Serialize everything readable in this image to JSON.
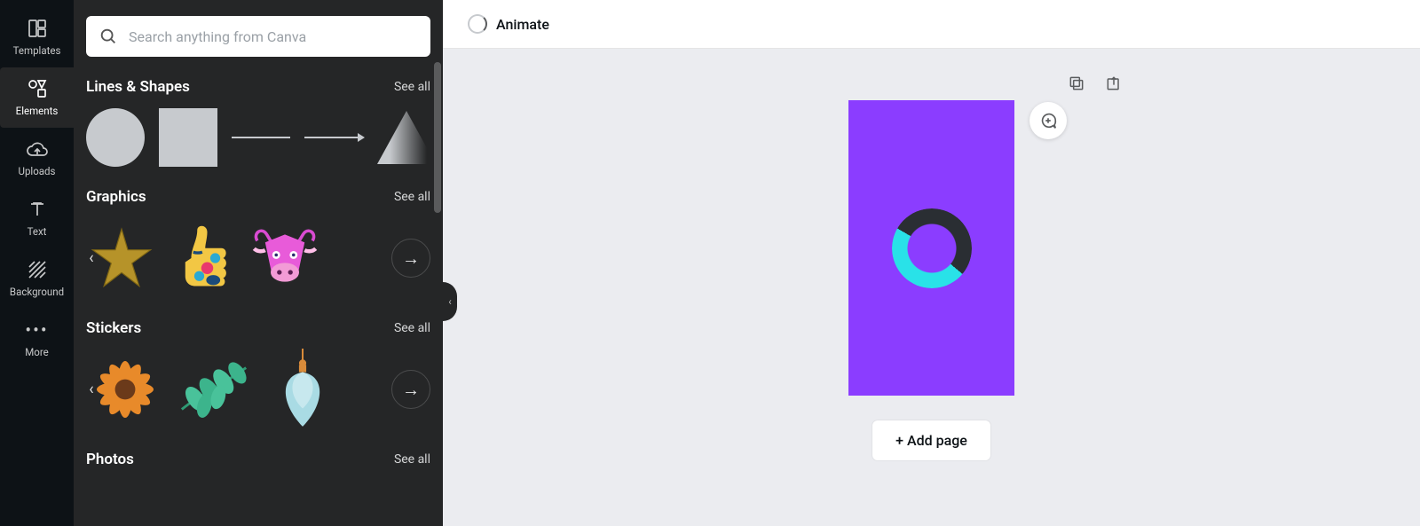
{
  "rail": {
    "items": [
      {
        "label": "Templates",
        "icon": "templates"
      },
      {
        "label": "Elements",
        "icon": "elements"
      },
      {
        "label": "Uploads",
        "icon": "uploads"
      },
      {
        "label": "Text",
        "icon": "text"
      },
      {
        "label": "Background",
        "icon": "background"
      },
      {
        "label": "More",
        "icon": "more"
      }
    ],
    "active_index": 1
  },
  "search": {
    "placeholder": "Search anything from Canva"
  },
  "sections": {
    "lines_shapes": {
      "title": "Lines & Shapes",
      "see_all": "See all"
    },
    "graphics": {
      "title": "Graphics",
      "see_all": "See all"
    },
    "stickers": {
      "title": "Stickers",
      "see_all": "See all"
    },
    "photos": {
      "title": "Photos",
      "see_all": "See all"
    }
  },
  "topbar": {
    "animate": "Animate"
  },
  "canvas": {
    "add_page_label": "+ Add page",
    "page_bg": "#8b3dff",
    "loader_colors": {
      "dark": "#2a2e33",
      "accent": "#29e2e8"
    }
  }
}
